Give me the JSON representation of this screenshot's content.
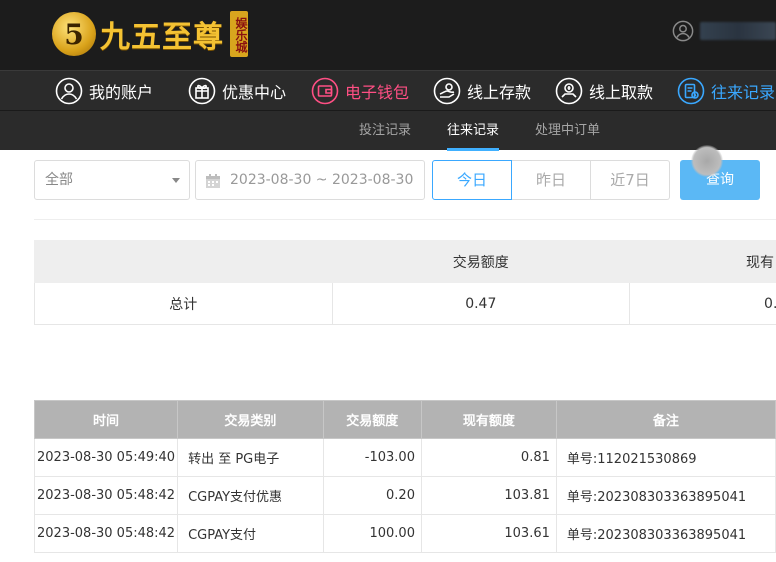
{
  "header": {
    "logo_mark": "5",
    "logo_text": "九五至尊",
    "logo_tag": "娱乐城"
  },
  "nav": {
    "items": [
      {
        "label": "我的账户",
        "icon": "user-icon"
      },
      {
        "label": "优惠中心",
        "icon": "gift-icon"
      },
      {
        "label": "电子钱包",
        "icon": "wallet-icon"
      },
      {
        "label": "线上存款",
        "icon": "deposit-icon"
      },
      {
        "label": "线上取款",
        "icon": "withdraw-icon"
      },
      {
        "label": "往来记录",
        "icon": "records-icon"
      }
    ]
  },
  "subnav": {
    "items": [
      {
        "label": "投注记录"
      },
      {
        "label": "往来记录"
      },
      {
        "label": "处理中订单"
      }
    ]
  },
  "filter": {
    "type_value": "全部",
    "date_range": "2023-08-30 ~ 2023-08-30",
    "ranges": [
      "今日",
      "昨日",
      "近7日"
    ],
    "query_label": "查询"
  },
  "summary": {
    "headers": [
      "",
      "交易额度",
      "现有"
    ],
    "row": {
      "label": "总计",
      "amount": "0.47",
      "balance": "0."
    }
  },
  "records": {
    "headers": [
      "时间",
      "交易类别",
      "交易额度",
      "现有额度",
      "备注"
    ],
    "rows": [
      {
        "time": "2023-08-30 05:49:40",
        "type": "转出 至 PG电子",
        "amount": "-103.00",
        "balance": "0.81",
        "note": "单号:112021530869"
      },
      {
        "time": "2023-08-30 05:48:42",
        "type": "CGPAY支付优惠",
        "amount": "0.20",
        "balance": "103.81",
        "note": "单号:202308303363895041"
      },
      {
        "time": "2023-08-30 05:48:42",
        "type": "CGPAY支付",
        "amount": "100.00",
        "balance": "103.61",
        "note": "单号:202308303363895041"
      }
    ]
  },
  "colors": {
    "header_bg": "#1c1c1c",
    "nav_bg": "#2b2b2b",
    "accent_blue": "#3aa8ff",
    "accent_pink": "#ff4f84",
    "query_bg": "#5bb8f5",
    "table_head_bg": "#b3b3b3"
  }
}
